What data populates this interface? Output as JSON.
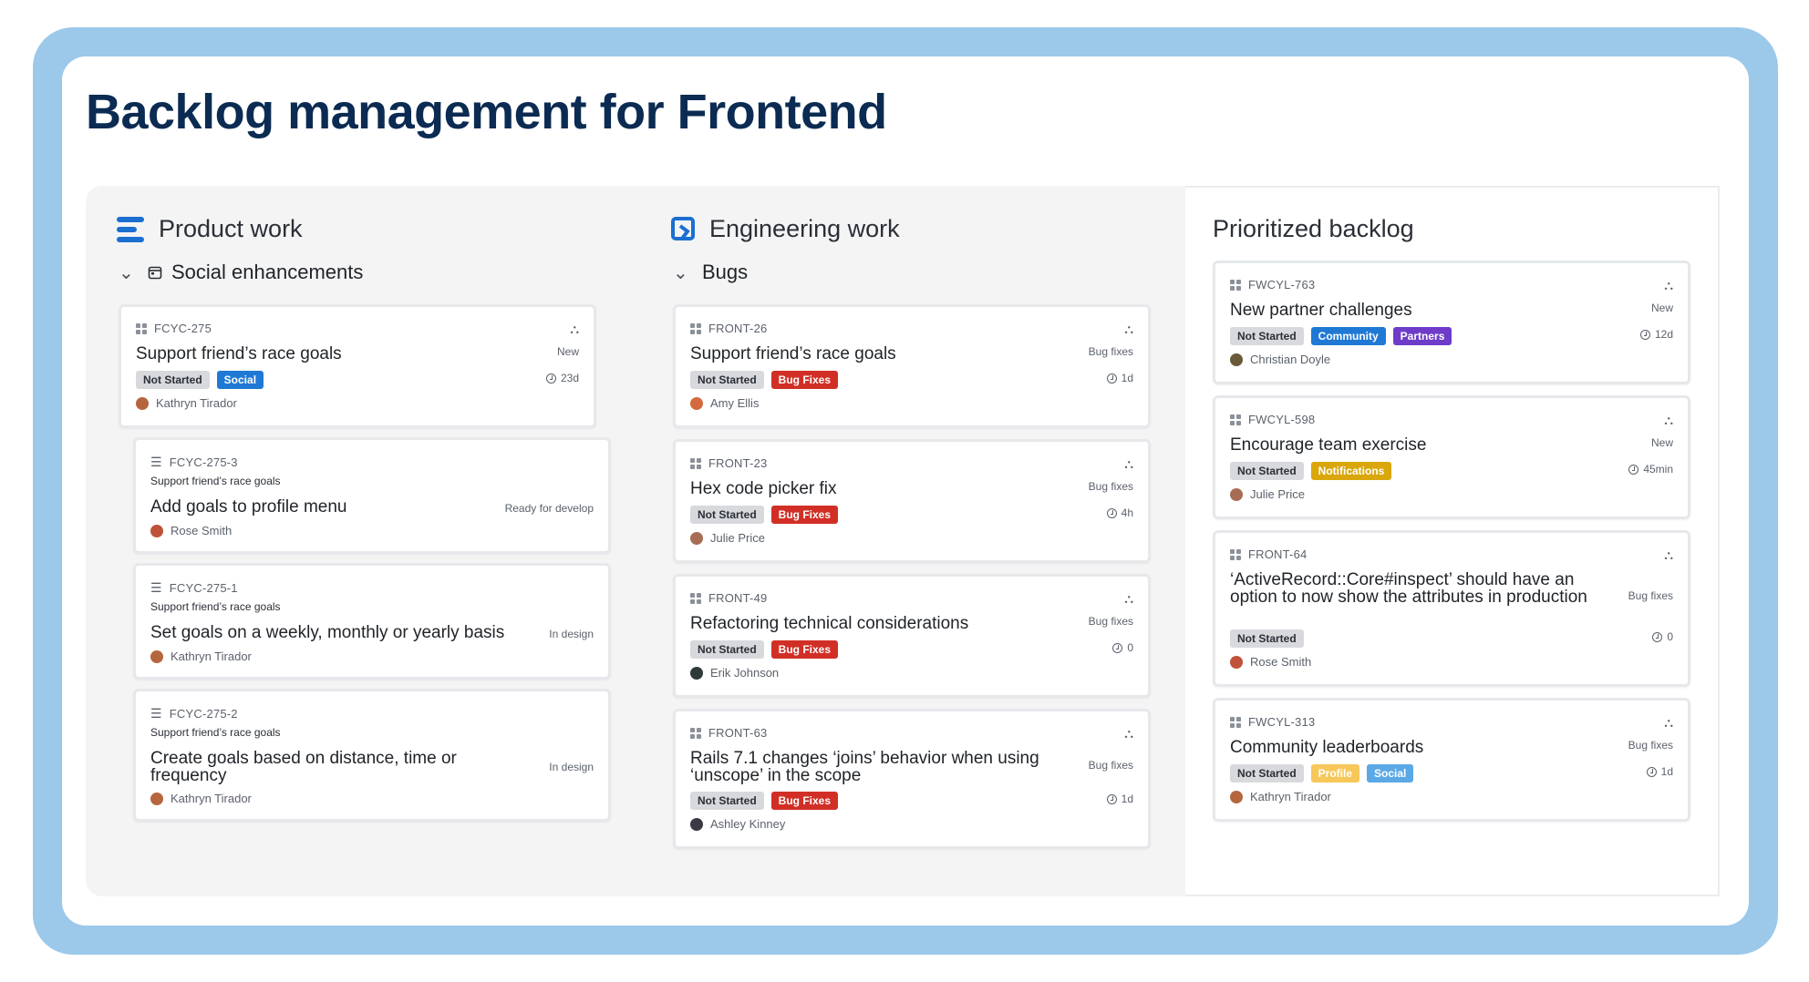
{
  "title": "Backlog management for Frontend",
  "colors": {
    "frame": "#9cc8ea",
    "title": "#0b2b52",
    "bug_tag": "#d12f26",
    "social_tag": "#1f79d4"
  },
  "columns": {
    "product": {
      "title": "Product work",
      "icon": "product-lines-icon",
      "group": "Social enhancements",
      "main_card": {
        "key": "FCYC-275",
        "name": "Support friend’s race goals",
        "status": "New",
        "tags": [
          "Not Started",
          "Social"
        ],
        "time": "23d",
        "assignee": "Kathryn Tirador"
      },
      "subtasks": [
        {
          "key": "FCYC-275-3",
          "parent": "Support friend’s race goals",
          "name": "Add goals to profile menu",
          "status": "Ready for develop",
          "assignee": "Rose Smith"
        },
        {
          "key": "FCYC-275-1",
          "parent": "Support friend’s race goals",
          "name": "Set goals on a weekly, monthly or yearly basis",
          "status": "In design",
          "assignee": "Kathryn Tirador"
        },
        {
          "key": "FCYC-275-2",
          "parent": "Support friend’s race goals",
          "name": "Create goals based on distance, time or frequency",
          "status": "In design",
          "assignee": "Kathryn Tirador"
        }
      ]
    },
    "engineering": {
      "title": "Engineering work",
      "icon": "jira-square-icon",
      "group": "Bugs",
      "cards": [
        {
          "key": "FRONT-26",
          "name": "Support friend’s race goals",
          "status": "Bug fixes",
          "tags": [
            "Not Started",
            "Bug Fixes"
          ],
          "time": "1d",
          "assignee": "Amy Ellis"
        },
        {
          "key": "FRONT-23",
          "name": "Hex code picker fix",
          "status": "Bug fixes",
          "tags": [
            "Not Started",
            "Bug Fixes"
          ],
          "time": "4h",
          "assignee": "Julie Price"
        },
        {
          "key": "FRONT-49",
          "name": "Refactoring technical considerations",
          "status": "Bug fixes",
          "tags": [
            "Not Started",
            "Bug Fixes"
          ],
          "time": "0",
          "assignee": "Erik Johnson"
        },
        {
          "key": "FRONT-63",
          "name": "Rails 7.1 changes ‘joins’ behavior when using ‘unscope’ in the scope",
          "status": "Bug fixes",
          "tags": [
            "Not Started",
            "Bug Fixes"
          ],
          "time": "1d",
          "assignee": "Ashley Kinney"
        }
      ]
    },
    "prioritized": {
      "title": "Prioritized backlog",
      "cards": [
        {
          "key": "FWCYL-763",
          "name": "New partner challenges",
          "status": "New",
          "tags": [
            "Not Started",
            "Community",
            "Partners"
          ],
          "time": "12d",
          "assignee": "Christian Doyle"
        },
        {
          "key": "FWCYL-598",
          "name": "Encourage team exercise",
          "status": "New",
          "tags": [
            "Not Started",
            "Notifications"
          ],
          "time": "45min",
          "assignee": "Julie Price"
        },
        {
          "key": "FRONT-64",
          "name": "‘ActiveRecord::Core#inspect’ should have an option to now show the attributes in production",
          "status": "Bug fixes",
          "tags": [
            "Not Started"
          ],
          "time": "0",
          "assignee": "Rose Smith"
        },
        {
          "key": "FWCYL-313",
          "name": "Community leaderboards",
          "status": "Bug fixes",
          "tags": [
            "Not Started",
            "Profile",
            "Social"
          ],
          "time": "1d",
          "assignee": "Kathryn Tirador"
        }
      ]
    }
  }
}
